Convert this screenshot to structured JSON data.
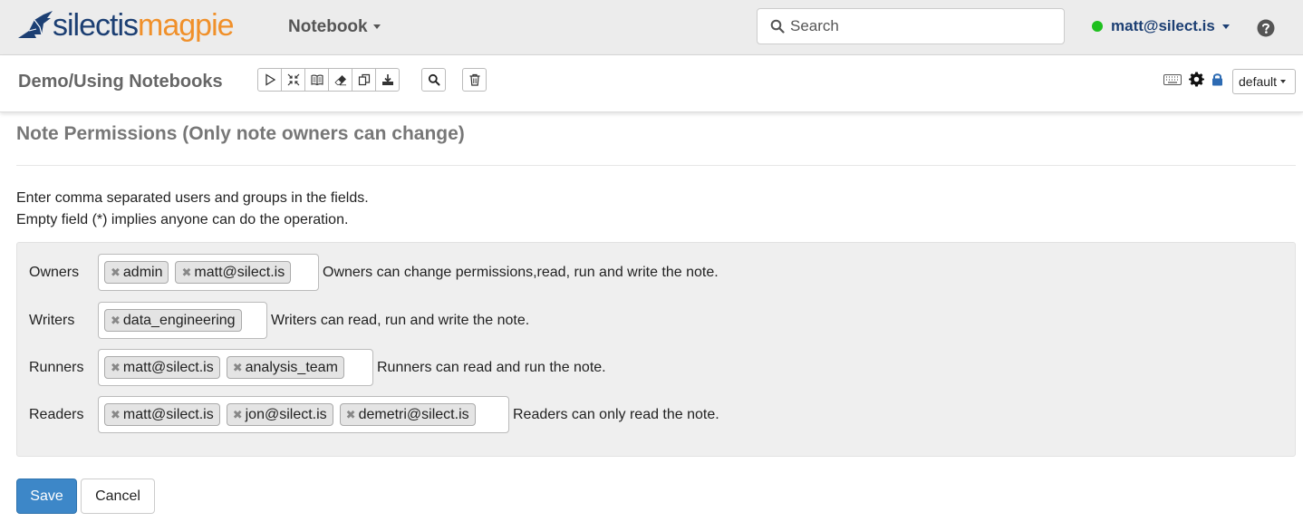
{
  "navbar": {
    "logo_part1": "silectis",
    "logo_part2": "magpie",
    "notebook_menu": "Notebook",
    "search_placeholder": "Search",
    "user": "matt@silect.is",
    "status_color": "#1ec01e"
  },
  "toolbar": {
    "note_title": "Demo/Using Notebooks",
    "buttons": [
      "run-all",
      "collapse",
      "toggle-code",
      "clear-output",
      "clone",
      "export",
      "search",
      "delete"
    ],
    "interpreter_select": "default"
  },
  "permissions": {
    "heading": "Note Permissions (Only note owners can change)",
    "help_line1": "Enter comma separated users and groups in the fields.",
    "help_line2": "Empty field (*) implies anyone can do the operation.",
    "rows": [
      {
        "label": "Owners",
        "tags": [
          "admin",
          "matt@silect.is"
        ],
        "description": "Owners can change permissions,read, run and write the note."
      },
      {
        "label": "Writers",
        "tags": [
          "data_engineering"
        ],
        "description": "Writers can read, run and write the note."
      },
      {
        "label": "Runners",
        "tags": [
          "matt@silect.is",
          "analysis_team"
        ],
        "description": "Runners can read and run the note."
      },
      {
        "label": "Readers",
        "tags": [
          "matt@silect.is",
          "jon@silect.is",
          "demetri@silect.is"
        ],
        "description": "Readers can only read the note."
      }
    ]
  },
  "actions": {
    "save_label": "Save",
    "cancel_label": "Cancel"
  },
  "colors": {
    "brand_dark": "#1c3f73",
    "brand_orange": "#f0902a",
    "primary_button": "#3d87c8"
  }
}
